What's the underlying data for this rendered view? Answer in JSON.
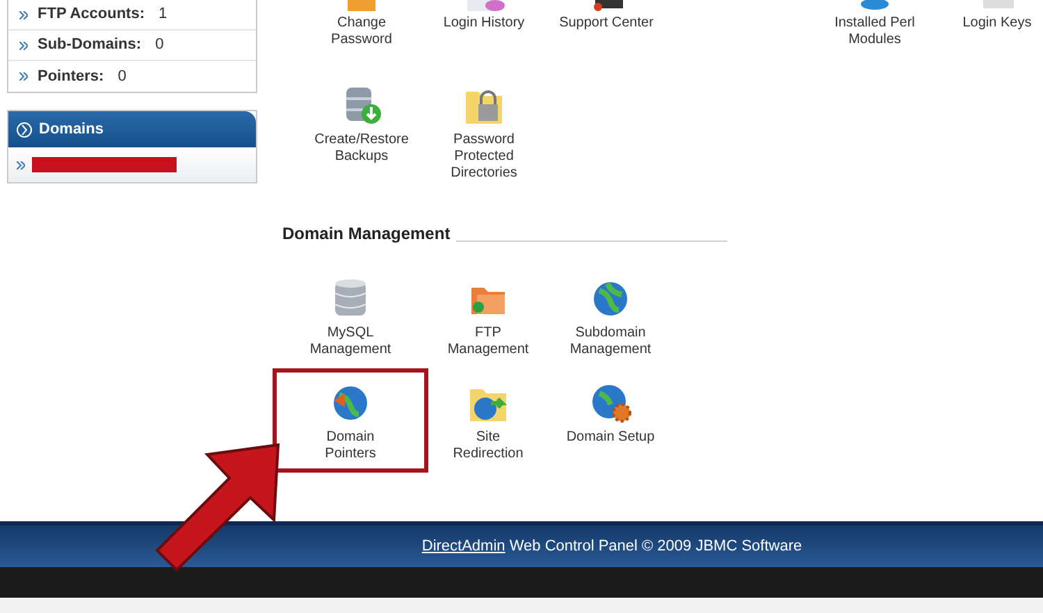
{
  "sidebar": {
    "stats": [
      {
        "label": "FTP Accounts:",
        "value": "1"
      },
      {
        "label": "Sub-Domains:",
        "value": "0"
      },
      {
        "label": "Pointers:",
        "value": "0"
      }
    ],
    "domains_panel": {
      "title": "Domains",
      "items": [
        {
          "kind": "redacted"
        }
      ]
    }
  },
  "top_icons": [
    {
      "label": "Change Password"
    },
    {
      "label": "Login History"
    },
    {
      "label": "Support Center"
    }
  ],
  "top_icons_right": [
    {
      "label": "Installed Perl Modules"
    },
    {
      "label": "Login Keys"
    }
  ],
  "backup_icons": [
    {
      "label": "Create/Restore Backups"
    },
    {
      "label": "Password Protected Directories"
    }
  ],
  "sections": [
    {
      "title": "Domain Management",
      "items": [
        {
          "label": "MySQL Management",
          "highlighted": false
        },
        {
          "label": "FTP Management",
          "highlighted": false
        },
        {
          "label": "Subdomain Management",
          "highlighted": false
        },
        {
          "label": "Domain Pointers",
          "highlighted": true
        },
        {
          "label": "Site Redirection",
          "highlighted": false
        },
        {
          "label": "Domain Setup",
          "highlighted": false
        }
      ]
    }
  ],
  "footer": {
    "link": "DirectAdmin",
    "text": "Web Control Panel © 2009 JBMC Software"
  }
}
